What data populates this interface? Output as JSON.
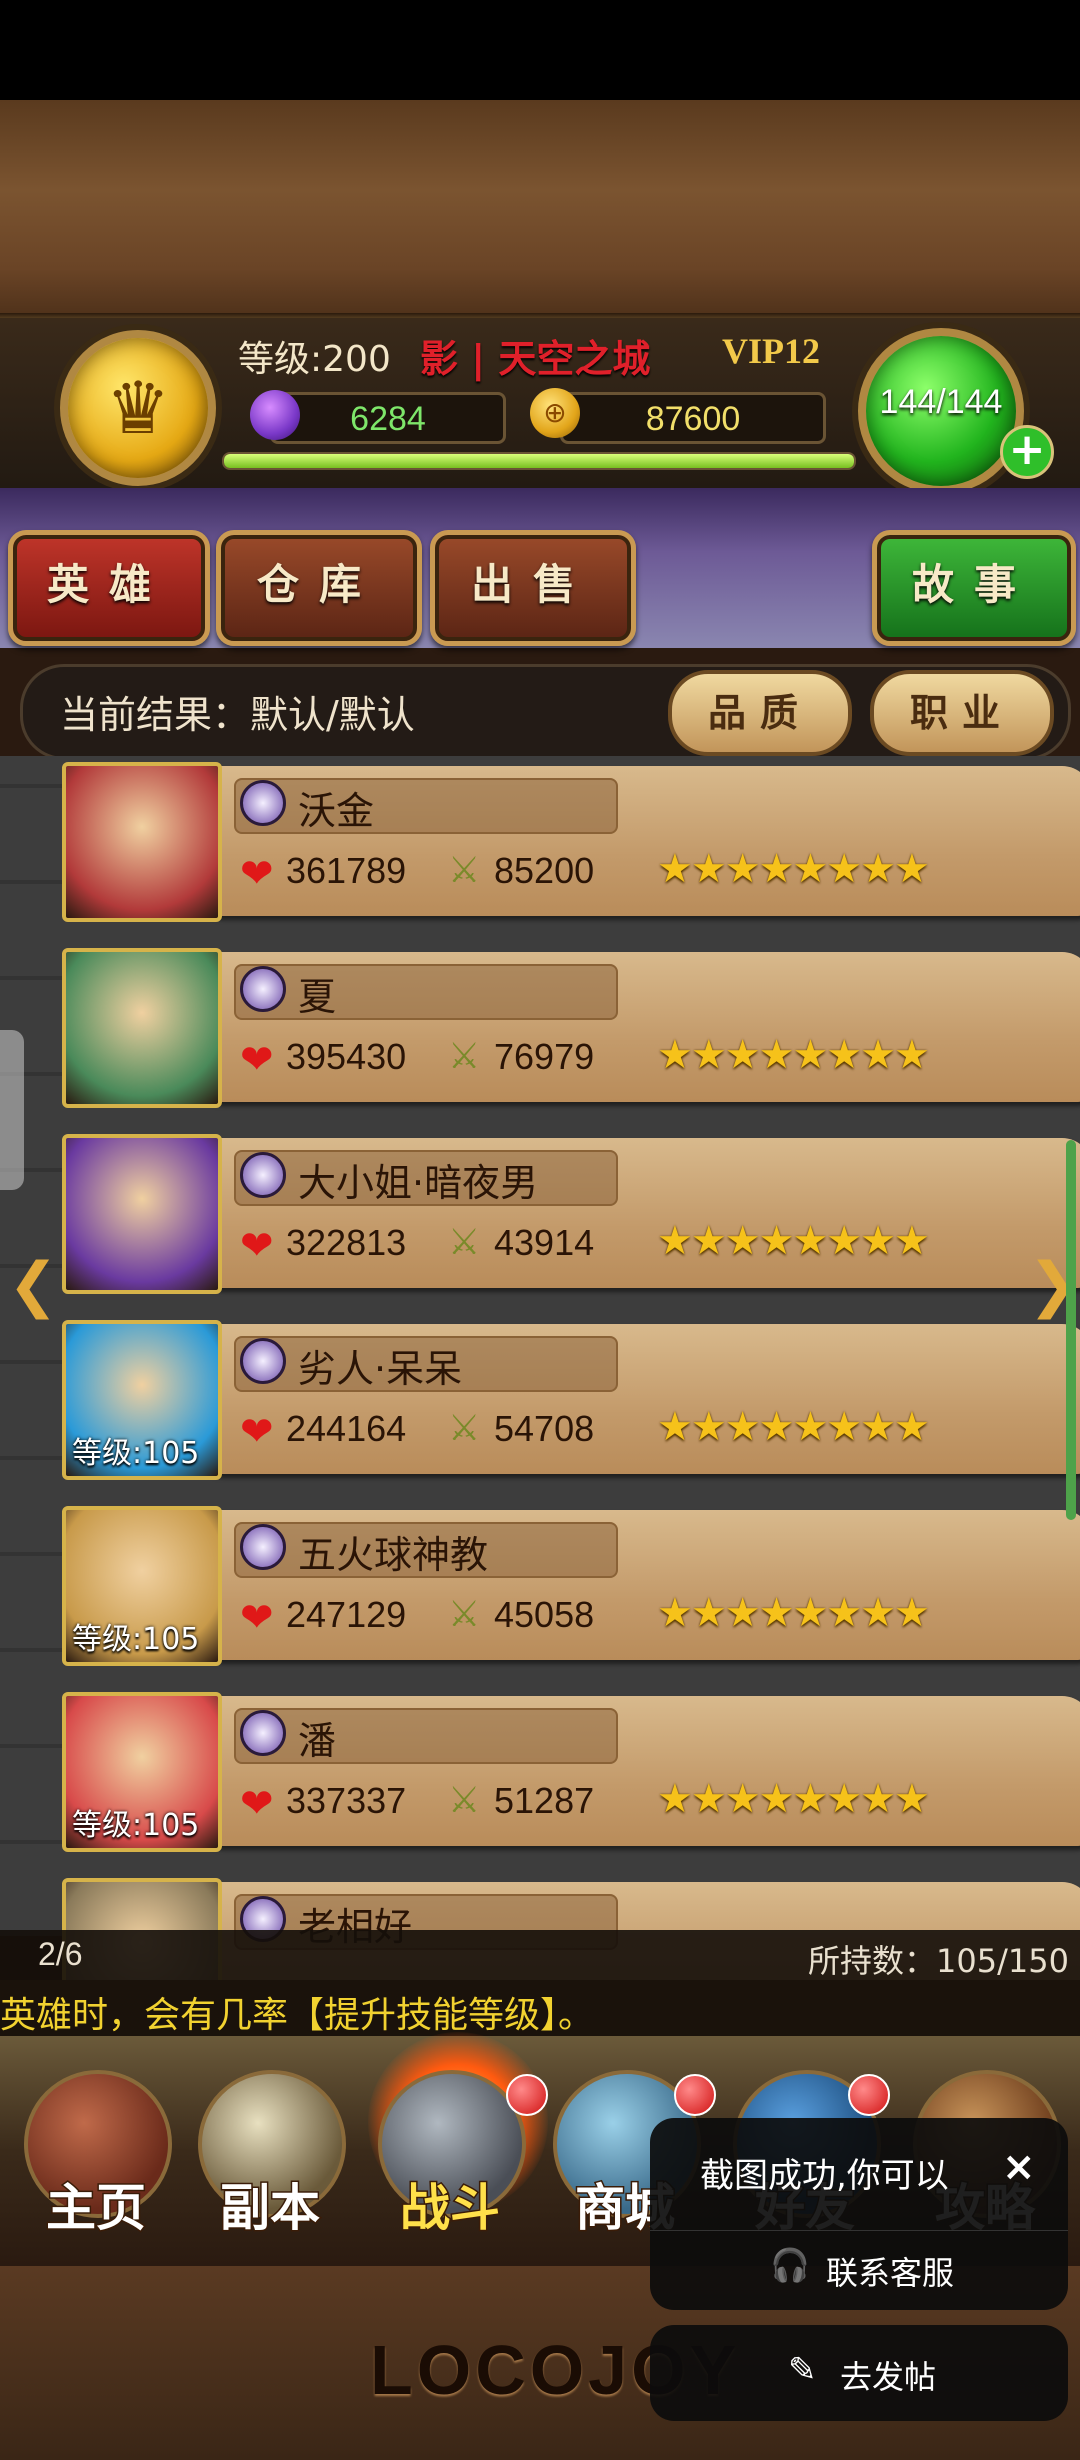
{
  "header": {
    "level_label": "等级:200",
    "guild_label": "影 | 天空之城",
    "vip_label": "VIP12",
    "gems": "6284",
    "gold": "87600",
    "hp": "144/144",
    "plus_symbol": "+",
    "crown_symbol": "♛",
    "gold_symbol": "⊕",
    "xp_fraction": 1.0
  },
  "tabs": [
    {
      "label": "英雄",
      "icon": ""
    },
    {
      "label": "仓库",
      "icon": ""
    },
    {
      "label": "出售",
      "icon": ""
    },
    {
      "label": "故事",
      "icon": ""
    }
  ],
  "filter": {
    "label": "当前结果：默认/默认",
    "quality_btn": "品质",
    "job_btn": "职业"
  },
  "heroes": [
    {
      "name": "沃金",
      "hp": "361789",
      "atk": "85200",
      "level": "",
      "stars": "★★★★★★★★",
      "color": "#b23a3a"
    },
    {
      "name": "夏",
      "hp": "395430",
      "atk": "76979",
      "level": "",
      "stars": "★★★★★★★★",
      "color": "#4a8a5a"
    },
    {
      "name": "大小姐·暗夜男",
      "hp": "322813",
      "atk": "43914",
      "level": "",
      "stars": "★★★★★★★★",
      "color": "#6a3aa0"
    },
    {
      "name": "劣人·呆呆",
      "hp": "244164",
      "atk": "54708",
      "level": "等级:105",
      "stars": "★★★★★★★★",
      "color": "#2a9ad8"
    },
    {
      "name": "五火球神教",
      "hp": "247129",
      "atk": "45058",
      "level": "等级:105",
      "stars": "★★★★★★★★",
      "color": "#c89a4a"
    },
    {
      "name": "潘",
      "hp": "337337",
      "atk": "51287",
      "level": "等级:105",
      "stars": "★★★★★★★★",
      "color": "#d84a4a"
    },
    {
      "name": "老相好",
      "hp": "",
      "atk": "",
      "level": "",
      "stars": "",
      "color": "#8a7a5a"
    }
  ],
  "pager": {
    "page": "2/6",
    "count": "所持数：105/150",
    "ticker": "英雄时，会有几率【提升技能等级】。"
  },
  "nav": [
    {
      "label": "主页",
      "icon": "home-icon"
    },
    {
      "label": "副本",
      "icon": "skull-icon"
    },
    {
      "label": "战斗",
      "icon": "battle-icon"
    },
    {
      "label": "商城",
      "icon": "shop-icon"
    },
    {
      "label": "好友",
      "icon": "friends-icon"
    },
    {
      "label": "攻略",
      "icon": "guide-icon"
    }
  ],
  "logo": "LOCOJOY",
  "toast": {
    "message": "截图成功,你可以",
    "close": "×",
    "support": "联系客服",
    "post": "去发帖"
  },
  "arrows": {
    "left": "❮",
    "right": "❯"
  },
  "icons": {
    "hp": "❤",
    "atk": "⚔",
    "support": "🎧",
    "post": "✎"
  }
}
